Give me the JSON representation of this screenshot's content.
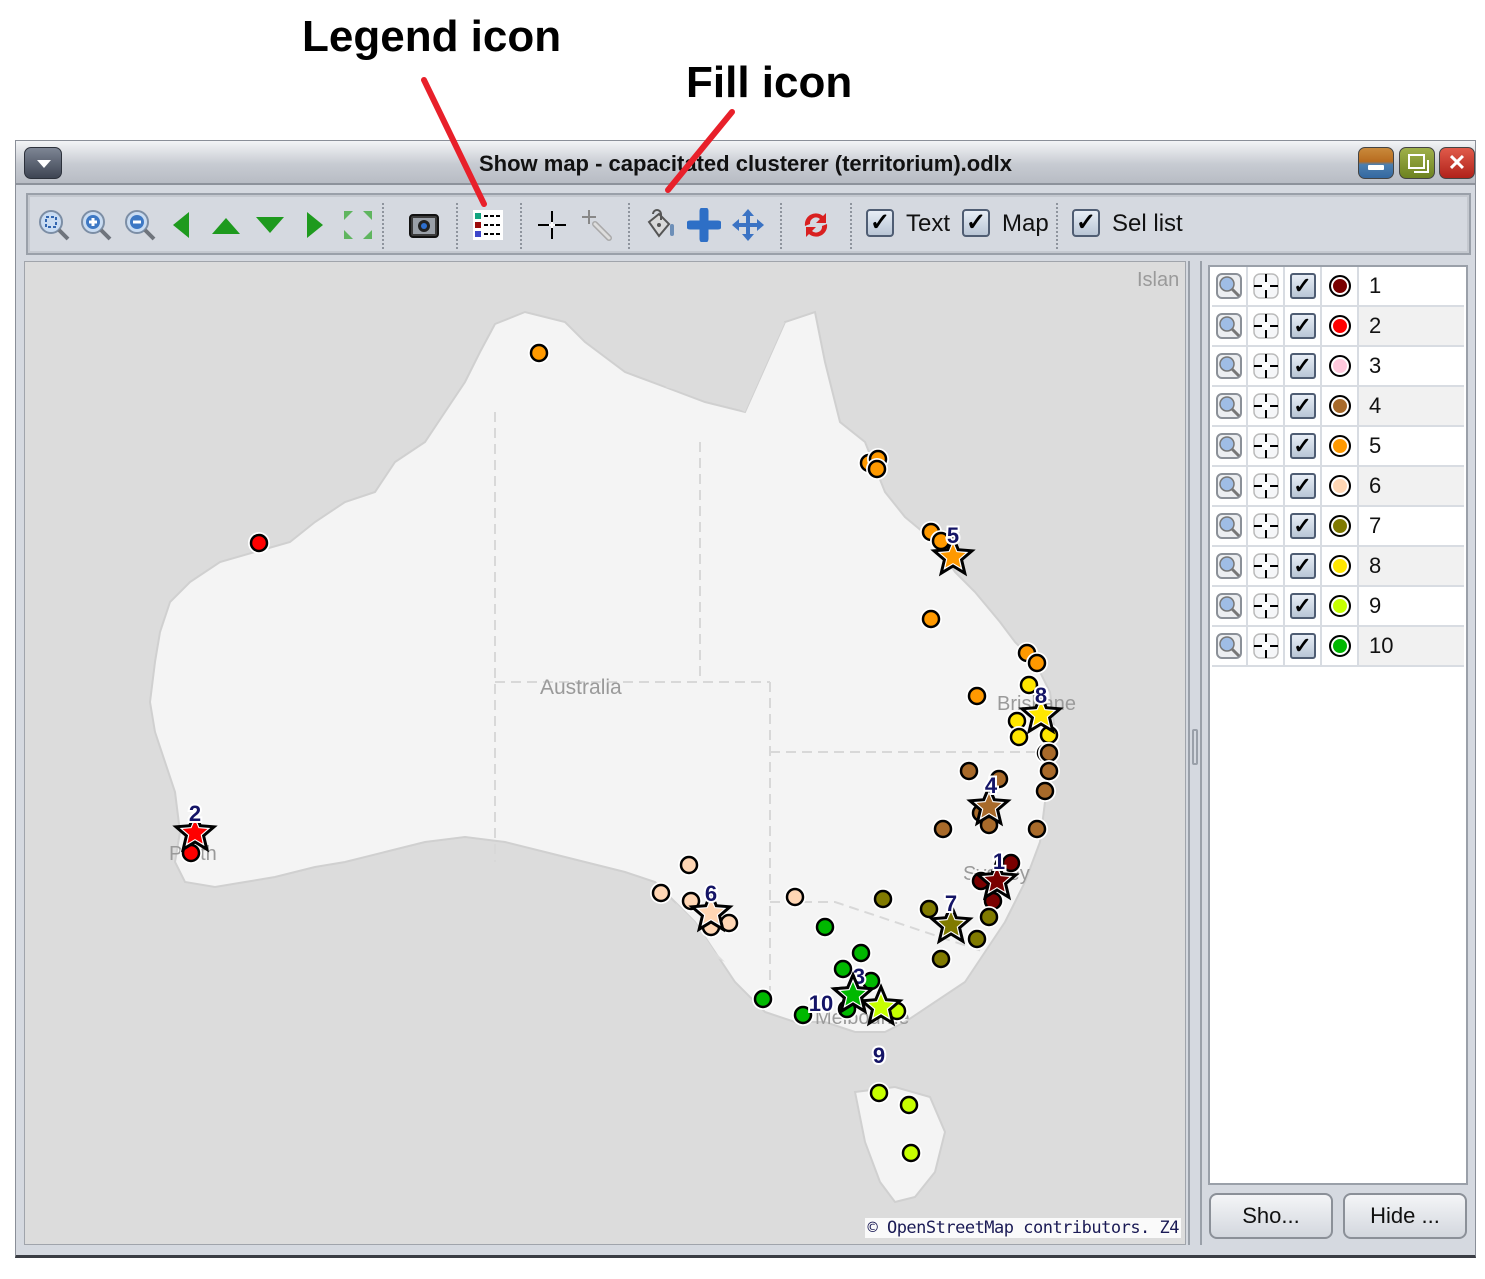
{
  "annotations": {
    "legend_label": "Legend icon",
    "fill_label": "Fill icon",
    "arrow_color": "#e8202a"
  },
  "window": {
    "title": "Show map - capacitated clusterer (territorium).odlx",
    "controls": [
      "system-menu",
      "minimize",
      "maximize",
      "close"
    ]
  },
  "toolbar": {
    "buttons": [
      {
        "name": "zoom-fit-icon",
        "tooltip": "Zoom to fit"
      },
      {
        "name": "zoom-in-icon",
        "tooltip": "Zoom in"
      },
      {
        "name": "zoom-out-icon",
        "tooltip": "Zoom out"
      },
      {
        "name": "pan-left-icon",
        "tooltip": "Pan left"
      },
      {
        "name": "pan-up-icon",
        "tooltip": "Pan up"
      },
      {
        "name": "pan-down-icon",
        "tooltip": "Pan down"
      },
      {
        "name": "pan-right-icon",
        "tooltip": "Pan right"
      },
      {
        "name": "fullscreen-icon",
        "tooltip": "Full extent"
      },
      {
        "name": "camera-icon",
        "tooltip": "Snapshot"
      },
      {
        "name": "legend-icon",
        "tooltip": "Legend"
      },
      {
        "name": "crosshair-icon",
        "tooltip": "Select"
      },
      {
        "name": "pointer-select-icon",
        "tooltip": "Select tool"
      },
      {
        "name": "fill-bucket-icon",
        "tooltip": "Fill"
      },
      {
        "name": "add-icon",
        "tooltip": "Add"
      },
      {
        "name": "move-icon",
        "tooltip": "Move"
      },
      {
        "name": "refresh-icon",
        "tooltip": "Refresh"
      }
    ],
    "checkboxes": [
      {
        "label": "Text",
        "checked": true
      },
      {
        "label": "Map",
        "checked": true
      },
      {
        "label": "Sel list",
        "checked": true
      }
    ],
    "legend_swatch_colors": [
      "#12a37f",
      "#9b0b0b",
      "#3d46c9"
    ]
  },
  "map": {
    "country_label": "Australia",
    "place_labels": [
      "Islan",
      "Brisbane",
      "Sydney",
      "Melbourne",
      "Perth"
    ],
    "attribution": "© OpenStreetMap contributors. Z4",
    "clusters": [
      {
        "id": "1",
        "color": "#7a0000"
      },
      {
        "id": "2",
        "color": "#ff0000"
      },
      {
        "id": "3",
        "color": "#ffc8dc"
      },
      {
        "id": "4",
        "color": "#a86a2a"
      },
      {
        "id": "5",
        "color": "#ff9900"
      },
      {
        "id": "6",
        "color": "#ffd6b4"
      },
      {
        "id": "7",
        "color": "#807a00"
      },
      {
        "id": "8",
        "color": "#ffe600"
      },
      {
        "id": "9",
        "color": "#c6ff00"
      },
      {
        "id": "10",
        "color": "#00b800"
      }
    ]
  },
  "side_panel": {
    "rows": [
      {
        "label": "1",
        "color": "#7a0000",
        "checked": true
      },
      {
        "label": "2",
        "color": "#ff0000",
        "checked": true
      },
      {
        "label": "3",
        "color": "#ffc8dc",
        "checked": true
      },
      {
        "label": "4",
        "color": "#a86a2a",
        "checked": true
      },
      {
        "label": "5",
        "color": "#ff9900",
        "checked": true
      },
      {
        "label": "6",
        "color": "#ffd6b4",
        "checked": true
      },
      {
        "label": "7",
        "color": "#807a00",
        "checked": true
      },
      {
        "label": "8",
        "color": "#ffe600",
        "checked": true
      },
      {
        "label": "9",
        "color": "#c6ff00",
        "checked": true
      },
      {
        "label": "10",
        "color": "#00b800",
        "checked": true
      }
    ],
    "show_button": "Sho...",
    "hide_button": "Hide ..."
  }
}
